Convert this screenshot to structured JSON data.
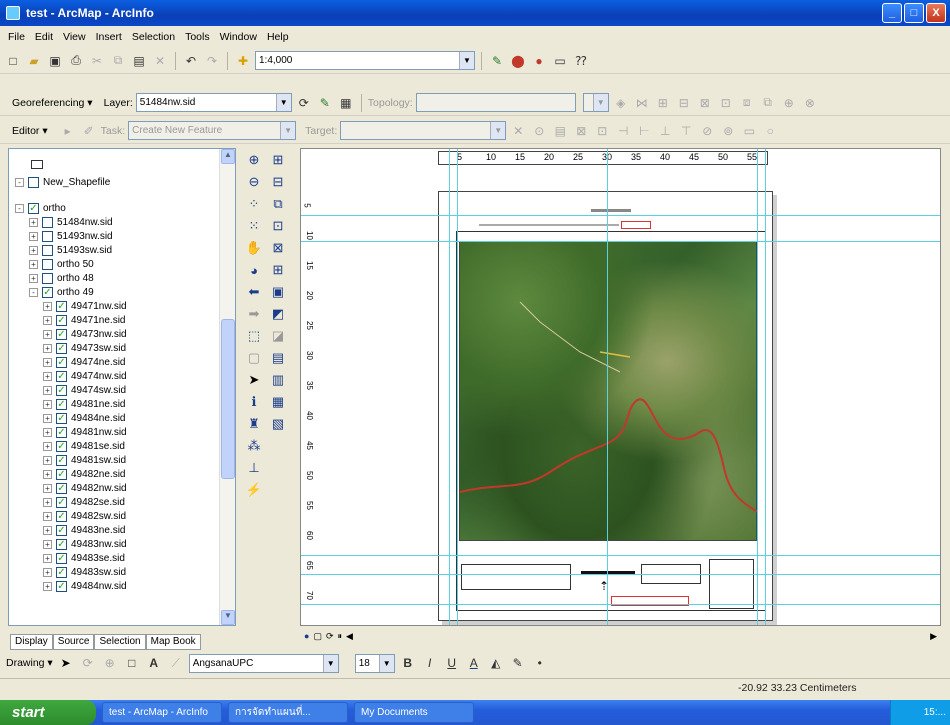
{
  "window": {
    "title": "test - ArcMap - ArcInfo",
    "minimize": "_",
    "maximize": "□",
    "close": "X"
  },
  "menu": [
    "File",
    "Edit",
    "View",
    "Insert",
    "Selection",
    "Tools",
    "Window",
    "Help"
  ],
  "standard_toolbar": {
    "scale": "1:4,000"
  },
  "georef_toolbar": {
    "georeferencing_label": "Georeferencing ▾",
    "layer_label": "Layer:",
    "layer_value": "51484nw.sid",
    "topology_label": "Topology:"
  },
  "editor_toolbar": {
    "editor_label": "Editor ▾",
    "task_label": "Task:",
    "task_value": "Create New Feature",
    "target_label": "Target:"
  },
  "toc": {
    "items": [
      {
        "label": "New_Shapefile",
        "checked": false,
        "indent": 1,
        "expander": "-"
      },
      {
        "label": "ortho",
        "checked": true,
        "indent": 1,
        "expander": "-"
      },
      {
        "label": "51484nw.sid",
        "checked": false,
        "indent": 2,
        "expander": "+"
      },
      {
        "label": "51493nw.sid",
        "checked": false,
        "indent": 2,
        "expander": "+"
      },
      {
        "label": "51493sw.sid",
        "checked": false,
        "indent": 2,
        "expander": "+"
      },
      {
        "label": "ortho 50",
        "checked": false,
        "indent": 2,
        "expander": "+"
      },
      {
        "label": "ortho 48",
        "checked": false,
        "indent": 2,
        "expander": "+"
      },
      {
        "label": "ortho 49",
        "checked": true,
        "indent": 2,
        "expander": "-"
      },
      {
        "label": "49471nw.sid",
        "checked": true,
        "indent": 3,
        "expander": "+"
      },
      {
        "label": "49471ne.sid",
        "checked": true,
        "indent": 3,
        "expander": "+"
      },
      {
        "label": "49473nw.sid",
        "checked": true,
        "indent": 3,
        "expander": "+"
      },
      {
        "label": "49473sw.sid",
        "checked": true,
        "indent": 3,
        "expander": "+"
      },
      {
        "label": "49474ne.sid",
        "checked": true,
        "indent": 3,
        "expander": "+"
      },
      {
        "label": "49474nw.sid",
        "checked": true,
        "indent": 3,
        "expander": "+"
      },
      {
        "label": "49474sw.sid",
        "checked": true,
        "indent": 3,
        "expander": "+"
      },
      {
        "label": "49481ne.sid",
        "checked": true,
        "indent": 3,
        "expander": "+"
      },
      {
        "label": "49484ne.sid",
        "checked": true,
        "indent": 3,
        "expander": "+"
      },
      {
        "label": "49481nw.sid",
        "checked": true,
        "indent": 3,
        "expander": "+"
      },
      {
        "label": "49481se.sid",
        "checked": true,
        "indent": 3,
        "expander": "+"
      },
      {
        "label": "49481sw.sid",
        "checked": true,
        "indent": 3,
        "expander": "+"
      },
      {
        "label": "49482ne.sid",
        "checked": true,
        "indent": 3,
        "expander": "+"
      },
      {
        "label": "49482nw.sid",
        "checked": true,
        "indent": 3,
        "expander": "+"
      },
      {
        "label": "49482se.sid",
        "checked": true,
        "indent": 3,
        "expander": "+"
      },
      {
        "label": "49482sw.sid",
        "checked": true,
        "indent": 3,
        "expander": "+"
      },
      {
        "label": "49483ne.sid",
        "checked": true,
        "indent": 3,
        "expander": "+"
      },
      {
        "label": "49483nw.sid",
        "checked": true,
        "indent": 3,
        "expander": "+"
      },
      {
        "label": "49483se.sid",
        "checked": true,
        "indent": 3,
        "expander": "+"
      },
      {
        "label": "49483sw.sid",
        "checked": true,
        "indent": 3,
        "expander": "+"
      },
      {
        "label": "49484nw.sid",
        "checked": true,
        "indent": 3,
        "expander": "+"
      }
    ],
    "tabs": [
      "Display",
      "Source",
      "Selection",
      "Map Book"
    ]
  },
  "ruler_top": [
    "5",
    "10",
    "15",
    "20",
    "25",
    "30",
    "35",
    "40",
    "45",
    "50",
    "55"
  ],
  "ruler_left": [
    "5",
    "10",
    "15",
    "20",
    "25",
    "30",
    "35",
    "40",
    "45",
    "50",
    "55",
    "60",
    "65",
    "70"
  ],
  "drawing_toolbar": {
    "drawing_label": "Drawing ▾",
    "font": "AngsanaUPC",
    "size": "18"
  },
  "status": {
    "coords": "-20.92  33.23 Centimeters"
  },
  "taskbar": {
    "start": "start",
    "tasks": [
      "test - ArcMap - ArcInfo",
      "การจัดทำแผนที่...",
      "My Documents"
    ],
    "clock": "15:..."
  }
}
